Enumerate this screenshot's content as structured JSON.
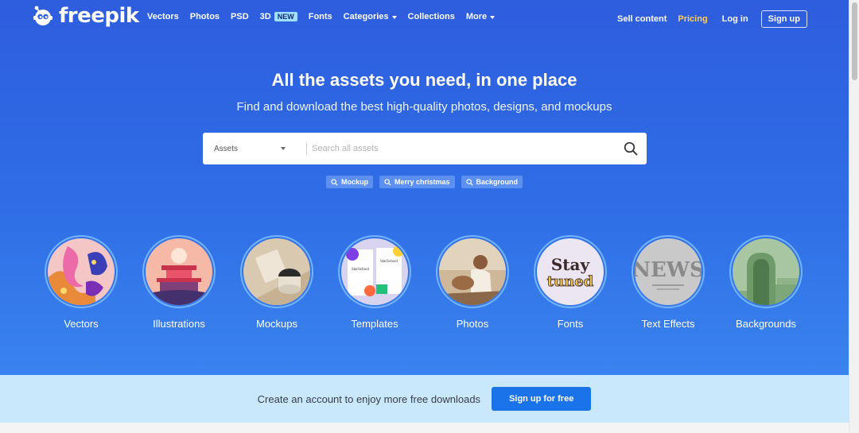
{
  "brand": {
    "name": "freepik"
  },
  "nav": {
    "items": [
      "Vectors",
      "Photos",
      "PSD",
      "3D",
      "Fonts",
      "Categories",
      "Collections",
      "More"
    ],
    "new_badge": "NEW",
    "sell": "Sell content",
    "pricing": "Pricing",
    "login": "Log in",
    "signup": "Sign up"
  },
  "hero": {
    "title": "All the assets you need, in one place",
    "subtitle": "Find and download the best high-quality photos, designs, and mockups"
  },
  "search": {
    "type": "Assets",
    "placeholder": "Search all assets"
  },
  "chips": [
    "Mockup",
    "Merry christmas",
    "Background"
  ],
  "categories": [
    {
      "label": "Vectors",
      "icon": "vectors-thumbnail"
    },
    {
      "label": "Illustrations",
      "icon": "illustrations-thumbnail"
    },
    {
      "label": "Mockups",
      "icon": "mockups-thumbnail"
    },
    {
      "label": "Templates",
      "icon": "templates-thumbnail"
    },
    {
      "label": "Photos",
      "icon": "photos-thumbnail"
    },
    {
      "label": "Fonts",
      "icon": "fonts-thumbnail"
    },
    {
      "label": "Text Effects",
      "icon": "text-effects-thumbnail"
    },
    {
      "label": "Backgrounds",
      "icon": "backgrounds-thumbnail"
    }
  ],
  "thumb_text": {
    "templates_a": "StarSchool",
    "templates_b": "StarSchool",
    "fonts_line1": "Stay",
    "fonts_line2": "tuned",
    "text_effects": "NEWS"
  },
  "banner": {
    "text": "Create an account to enjoy more free downloads",
    "button": "Sign up for free"
  },
  "colors": {
    "accent": "#1a73e8",
    "pricing": "#ffce5a",
    "badge": "#9fe0ff",
    "banner_bg": "#c9e8fb"
  }
}
